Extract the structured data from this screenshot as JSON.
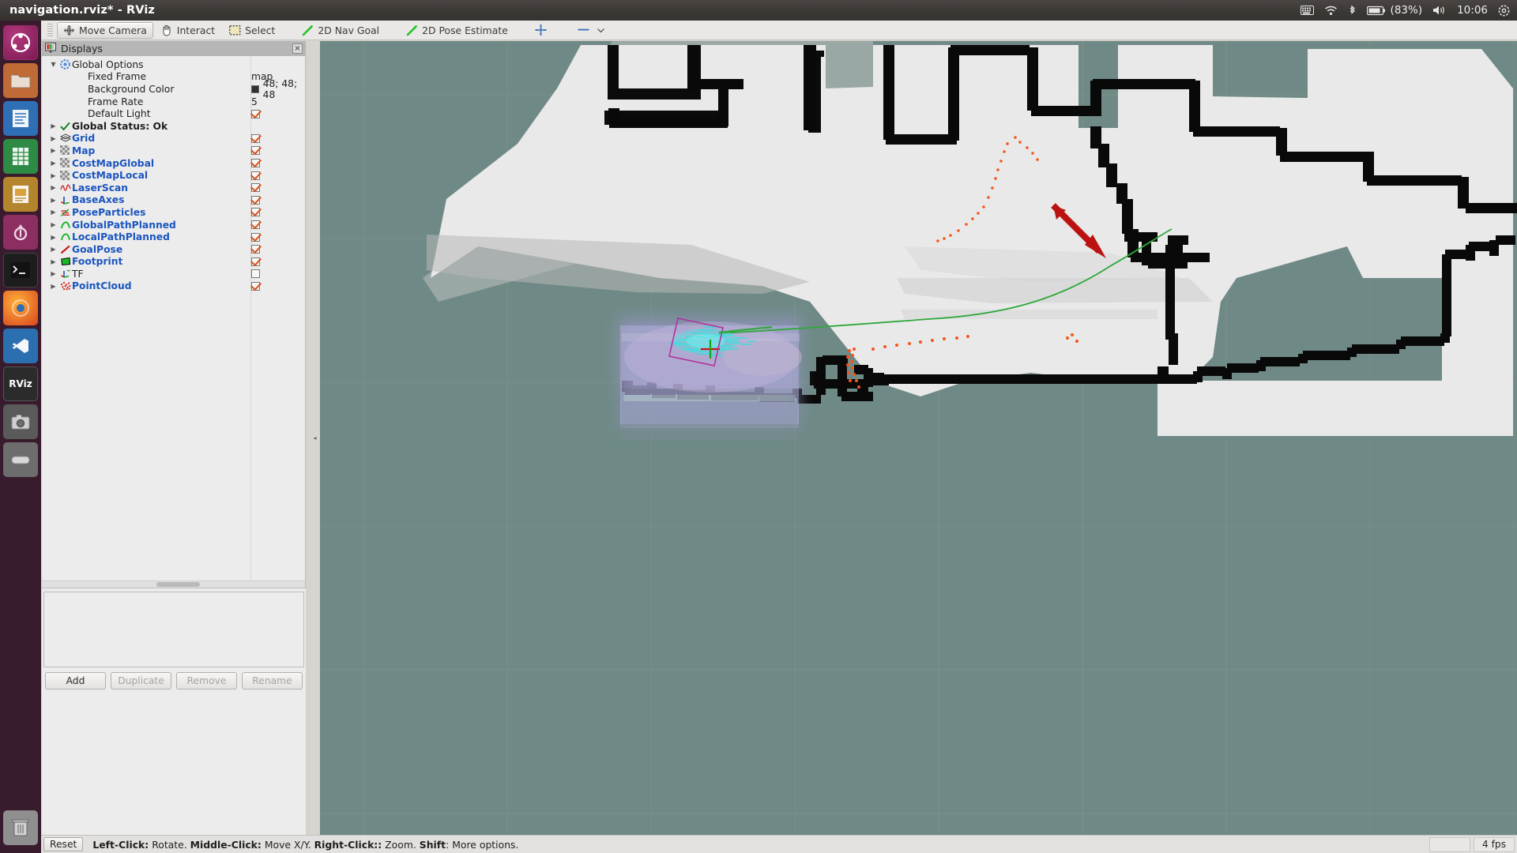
{
  "window": {
    "title": "navigation.rviz* - RViz"
  },
  "tray": {
    "icons": [
      "keyboard-icon",
      "wifi-icon",
      "bluetooth-icon",
      "battery-icon",
      "volume-icon",
      "gear-icon"
    ],
    "battery_percent": "(83%)",
    "clock": "10:06"
  },
  "launcher": {
    "items": [
      {
        "name": "ubuntu-dash-icon",
        "label": ""
      },
      {
        "name": "files-icon",
        "label": ""
      },
      {
        "name": "writer-icon",
        "label": ""
      },
      {
        "name": "calc-icon",
        "label": ""
      },
      {
        "name": "impress-icon",
        "label": ""
      },
      {
        "name": "software-center-icon",
        "label": ""
      },
      {
        "name": "terminal-icon",
        "label": ""
      },
      {
        "name": "firefox-icon",
        "label": ""
      },
      {
        "name": "vscode-icon",
        "label": ""
      },
      {
        "name": "rviz-icon",
        "label": "RViz"
      },
      {
        "name": "screenshot-icon",
        "label": ""
      },
      {
        "name": "disk-icon",
        "label": ""
      },
      {
        "name": "trash-icon",
        "label": ""
      }
    ]
  },
  "toolbar": {
    "buttons": [
      {
        "label": "Move Camera",
        "icon": "move-camera-icon",
        "checked": true
      },
      {
        "label": "Interact",
        "icon": "hand-icon",
        "checked": false
      },
      {
        "label": "Select",
        "icon": "select-rect-icon",
        "checked": false
      },
      {
        "label": "2D Nav Goal",
        "icon": "green-arrow-icon",
        "checked": false
      },
      {
        "label": "2D Pose Estimate",
        "icon": "green-arrow-icon",
        "checked": false
      },
      {
        "label": "",
        "icon": "focus-camera-icon",
        "checked": false
      },
      {
        "label": "",
        "icon": "measure-icon",
        "checked": false
      }
    ]
  },
  "displays": {
    "panel_title": "Displays",
    "close_label": "×",
    "tree": [
      {
        "label": "Global Options",
        "arrow": "open",
        "icon": "gear-icon",
        "style": "plain",
        "indent": 0,
        "value_type": "none",
        "value": ""
      },
      {
        "label": "Fixed Frame",
        "arrow": "none",
        "icon": "none",
        "style": "plain",
        "indent": 1,
        "value_type": "text",
        "value": "map"
      },
      {
        "label": "Background Color",
        "arrow": "none",
        "icon": "none",
        "style": "plain",
        "indent": 1,
        "value_type": "color",
        "value": "48; 48; 48"
      },
      {
        "label": "Frame Rate",
        "arrow": "none",
        "icon": "none",
        "style": "plain",
        "indent": 1,
        "value_type": "text",
        "value": "5"
      },
      {
        "label": "Default Light",
        "arrow": "none",
        "icon": "none",
        "style": "plain",
        "indent": 1,
        "value_type": "check",
        "value": "on"
      },
      {
        "label": "Global Status: Ok",
        "arrow": "closed",
        "icon": "check-icon",
        "style": "bold",
        "indent": 0,
        "value_type": "none",
        "value": ""
      },
      {
        "label": "Grid",
        "arrow": "closed",
        "icon": "grid-icon",
        "style": "link",
        "indent": 0,
        "value_type": "check",
        "value": "on"
      },
      {
        "label": "Map",
        "arrow": "closed",
        "icon": "map-icon",
        "style": "link",
        "indent": 0,
        "value_type": "check",
        "value": "on"
      },
      {
        "label": "CostMapGlobal",
        "arrow": "closed",
        "icon": "map-icon",
        "style": "link",
        "indent": 0,
        "value_type": "check",
        "value": "on"
      },
      {
        "label": "CostMapLocal",
        "arrow": "closed",
        "icon": "map-icon",
        "style": "link",
        "indent": 0,
        "value_type": "check",
        "value": "on"
      },
      {
        "label": "LaserScan",
        "arrow": "closed",
        "icon": "laserscan-icon",
        "style": "link",
        "indent": 0,
        "value_type": "check",
        "value": "on"
      },
      {
        "label": "BaseAxes",
        "arrow": "closed",
        "icon": "axes-icon",
        "style": "link",
        "indent": 0,
        "value_type": "check",
        "value": "on"
      },
      {
        "label": "PoseParticles",
        "arrow": "closed",
        "icon": "posearray-icon",
        "style": "link",
        "indent": 0,
        "value_type": "check",
        "value": "on"
      },
      {
        "label": "GlobalPathPlanned",
        "arrow": "closed",
        "icon": "path-icon",
        "style": "link",
        "indent": 0,
        "value_type": "check",
        "value": "on"
      },
      {
        "label": "LocalPathPlanned",
        "arrow": "closed",
        "icon": "path-icon",
        "style": "link",
        "indent": 0,
        "value_type": "check",
        "value": "on"
      },
      {
        "label": "GoalPose",
        "arrow": "closed",
        "icon": "pose-icon",
        "style": "link",
        "indent": 0,
        "value_type": "check",
        "value": "on"
      },
      {
        "label": "Footprint",
        "arrow": "closed",
        "icon": "polygon-icon",
        "style": "link",
        "indent": 0,
        "value_type": "check",
        "value": "on"
      },
      {
        "label": "TF",
        "arrow": "closed",
        "icon": "tf-icon",
        "style": "plain",
        "indent": 0,
        "value_type": "check",
        "value": "off"
      },
      {
        "label": "PointCloud",
        "arrow": "closed",
        "icon": "pointcloud-icon",
        "style": "link",
        "indent": 0,
        "value_type": "check",
        "value": "on"
      }
    ],
    "buttons": [
      {
        "label": "Add",
        "enabled": true
      },
      {
        "label": "Duplicate",
        "enabled": false
      },
      {
        "label": "Remove",
        "enabled": false
      },
      {
        "label": "Rename",
        "enabled": false
      }
    ]
  },
  "status_bar": {
    "reset_label": "Reset",
    "hint_segments": [
      {
        "text": "Left-Click:",
        "bold": true
      },
      {
        "text": " Rotate. ",
        "bold": false
      },
      {
        "text": "Middle-Click:",
        "bold": true
      },
      {
        "text": " Move X/Y. ",
        "bold": false
      },
      {
        "text": "Right-Click::",
        "bold": true
      },
      {
        "text": " Zoom. ",
        "bold": false
      },
      {
        "text": "Shift",
        "bold": true
      },
      {
        "text": ": More options.",
        "bold": false
      }
    ],
    "fps": "4 fps"
  },
  "render_view": {
    "background_color": "#6f8a86",
    "free_space_color": "#e8e8e8",
    "occupied_color": "#000000",
    "unknown_color": "#c9c9c9",
    "global_path_color": "#2bb53a",
    "laser_scan_color": "#ff5a1e",
    "particles_color": "#23e8e2",
    "goal_arrow_color": "#cc1414",
    "footprint_color": "#b0329b",
    "costmap_tint": "#b9b4de"
  }
}
